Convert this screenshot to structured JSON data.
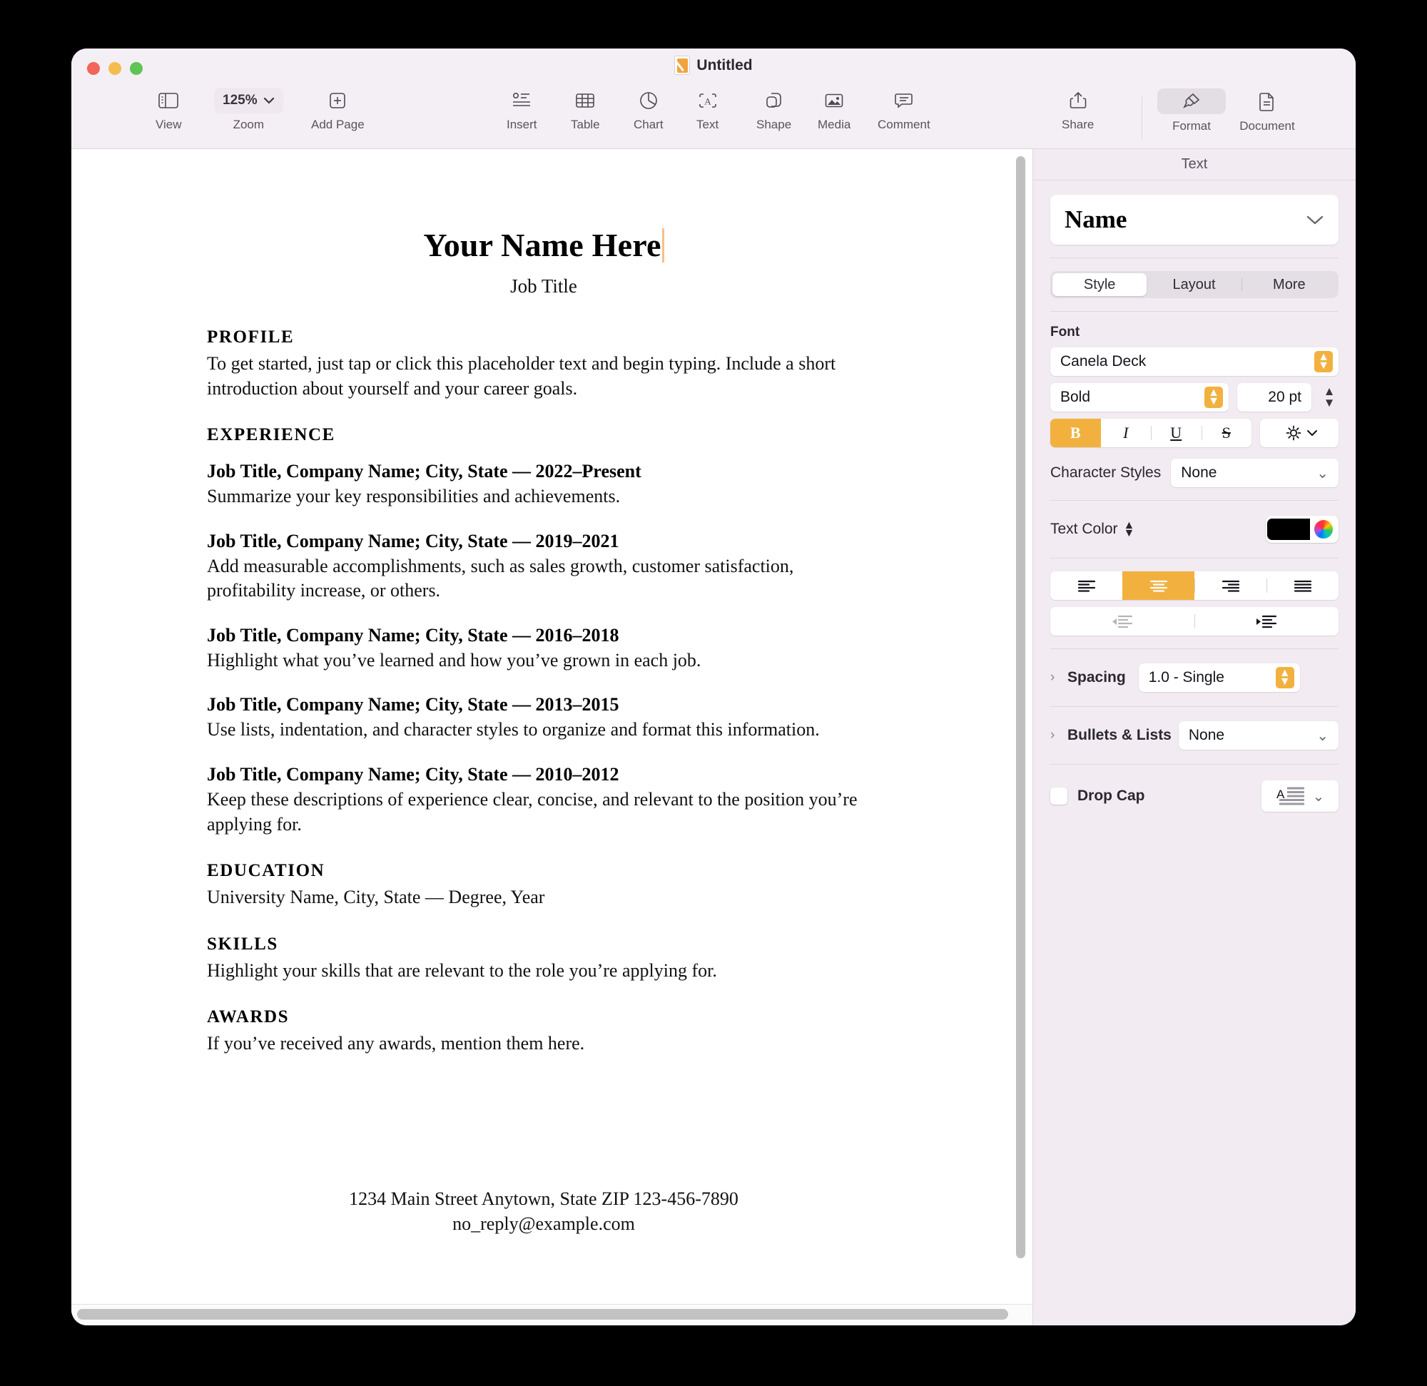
{
  "window": {
    "title": "Untitled",
    "title_icon": "document-pencil-icon"
  },
  "toolbar": {
    "items": [
      {
        "label": "View",
        "icon": "sidebar-icon"
      },
      {
        "label": "Zoom",
        "icon": "chevron-down-icon",
        "value": "125%"
      },
      {
        "label": "Add Page",
        "icon": "plus-page-icon"
      },
      {
        "label": "Insert",
        "icon": "insert-icon"
      },
      {
        "label": "Table",
        "icon": "table-icon"
      },
      {
        "label": "Chart",
        "icon": "pie-chart-icon"
      },
      {
        "label": "Text",
        "icon": "text-box-icon"
      },
      {
        "label": "Shape",
        "icon": "shape-icon"
      },
      {
        "label": "Media",
        "icon": "media-image-icon"
      },
      {
        "label": "Comment",
        "icon": "comment-icon"
      },
      {
        "label": "Share",
        "icon": "share-icon"
      },
      {
        "label": "Format",
        "icon": "paintbrush-icon"
      },
      {
        "label": "Document",
        "icon": "document-icon"
      }
    ]
  },
  "inspector": {
    "panel_title": "Text",
    "paragraph_style": "Name",
    "tabs": [
      {
        "label": "Style",
        "active": true
      },
      {
        "label": "Layout",
        "active": false
      },
      {
        "label": "More",
        "active": false
      }
    ],
    "font_group_label": "Font",
    "font_family": "Canela Deck",
    "font_style": "Bold",
    "font_size": "20 pt",
    "typeface_buttons": [
      {
        "label": "B",
        "name": "bold-button",
        "active": true
      },
      {
        "label": "I",
        "name": "italic-button",
        "active": false
      },
      {
        "label": "U",
        "name": "underline-button",
        "active": false
      },
      {
        "label": "S",
        "name": "strikethrough-button",
        "active": false
      }
    ],
    "character_styles_label": "Character Styles",
    "character_styles_value": "None",
    "text_color_label": "Text Color",
    "text_color_value": "#000000",
    "alignment": [
      {
        "name": "align-left-button",
        "active": false
      },
      {
        "name": "align-center-button",
        "active": true
      },
      {
        "name": "align-right-button",
        "active": false
      },
      {
        "name": "align-justify-button",
        "active": false
      }
    ],
    "indent": [
      {
        "name": "decrease-indent-button",
        "enabled": false
      },
      {
        "name": "increase-indent-button",
        "enabled": true
      }
    ],
    "spacing_label": "Spacing",
    "spacing_value": "1.0 - Single",
    "bullets_label": "Bullets & Lists",
    "bullets_value": "None",
    "dropcap_label": "Drop Cap",
    "dropcap_checked": false
  },
  "document": {
    "name": "Your Name Here",
    "job_title": "Job Title",
    "sections": [
      {
        "heading": "PROFILE",
        "body": "To get started, just tap or click this placeholder text and begin typing. Include a short introduction about yourself and your career goals."
      },
      {
        "heading": "EXPERIENCE",
        "entries": [
          {
            "title": "Job Title, Company Name; City, State — 2022–Present",
            "desc": "Summarize your key responsibilities and achievements."
          },
          {
            "title": "Job Title, Company Name; City, State — 2019–2021",
            "desc": "Add measurable accomplishments, such as sales growth, customer satisfaction, profitability increase, or others."
          },
          {
            "title": "Job Title, Company Name; City, State — 2016–2018",
            "desc": "Highlight what you’ve learned and how you’ve grown in each job."
          },
          {
            "title": "Job Title, Company Name; City, State — 2013–2015",
            "desc": "Use lists, indentation, and character styles to organize and format this information."
          },
          {
            "title": "Job Title, Company Name; City, State — 2010–2012",
            "desc": "Keep these descriptions of experience clear, concise, and relevant to the position you’re applying for."
          }
        ]
      },
      {
        "heading": "EDUCATION",
        "body": "University Name, City, State — Degree, Year"
      },
      {
        "heading": "SKILLS",
        "body": "Highlight your skills that are relevant to the role you’re applying for."
      },
      {
        "heading": "AWARDS",
        "body": "If you’ve received any awards, mention them here."
      }
    ],
    "footer_line1": "1234 Main Street Anytown, State ZIP   123-456-7890",
    "footer_line2": "no_reply@example.com"
  },
  "colors": {
    "accent_orange": "#f2b13f",
    "window_bg": "#f4eff4",
    "sidebar_bg": "#f2ecf2",
    "caret": "#f5c18a"
  }
}
